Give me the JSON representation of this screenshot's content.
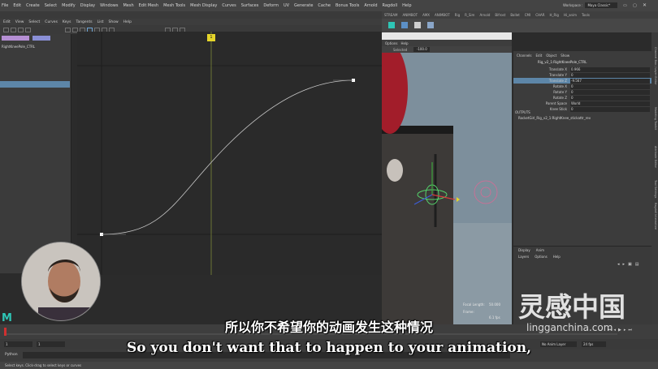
{
  "main_menu": [
    "File",
    "Edit",
    "Create",
    "Select",
    "Modify",
    "Display",
    "Windows",
    "Mesh",
    "Edit Mesh",
    "Mesh Tools",
    "Mesh Display",
    "Curves",
    "Surfaces",
    "Deform",
    "UV",
    "Generate",
    "Cache",
    "Bonus Tools",
    "Arnold",
    "Ragdoll",
    "Help"
  ],
  "workspace": {
    "label": "Workspace :",
    "value": "Maya Classic*"
  },
  "shelf_tabs": [
    "STREAM",
    "ANIMBOT",
    "AMX",
    "ANIMBOT",
    "Rig",
    "R_Sim",
    "Arnold",
    "Bifrost",
    "Ballet",
    "CMI",
    "CHAR",
    "H_Rig",
    "Hi_anim",
    "Tools"
  ],
  "graph_editor": {
    "menu": [
      "Edit",
      "View",
      "Select",
      "Curves",
      "Keys",
      "Tangents",
      "List",
      "Show",
      "Help"
    ],
    "node": "RightKneePole_CTRL",
    "frame_marker": "1",
    "curve_color": "#c8c8c8",
    "timeline_color": "#b5c24a"
  },
  "viewport": {
    "menu": [
      "Options",
      "Help"
    ],
    "selected_label": "Selected",
    "selected_value": "-100.0",
    "hud": {
      "focal_label": "Focal Length:",
      "focal_value": "50.000",
      "frame_label": "Frame:",
      "fps": "6.1 fps"
    }
  },
  "channel_box": {
    "tabs": [
      "Channels",
      "Edit",
      "Object",
      "Show"
    ],
    "node": "Rig_v2_1:RightKneePole_CTRL",
    "attributes": [
      {
        "name": "Translate X",
        "value": "0.966",
        "selected": false
      },
      {
        "name": "Translate Y",
        "value": "0",
        "selected": false
      },
      {
        "name": "Translate Z",
        "value": "-9.567",
        "selected": true
      },
      {
        "name": "Rotate X",
        "value": "0",
        "selected": false
      },
      {
        "name": "Rotate Y",
        "value": "0",
        "selected": false
      },
      {
        "name": "Rotate Z",
        "value": "0",
        "selected": false
      },
      {
        "name": "Parent Space",
        "value": "World",
        "selected": false
      },
      {
        "name": "Knee Stick",
        "value": "0",
        "selected": false
      }
    ],
    "outputs_label": "OUTPUTS",
    "output_node": "RocketGirl_Rig_v2_1:RightKnee_stickattr_rev"
  },
  "layer_editor": {
    "tabs": [
      "Display",
      "Anim"
    ],
    "menu": [
      "Layers",
      "Options",
      "Help"
    ]
  },
  "right_tabs": [
    "Channel Box / Layer Editor",
    "Modeling Toolkit",
    "Attribute Editor",
    "Tool Settings",
    "Ragdoll Interactive"
  ],
  "range": {
    "start": "1",
    "end": "1",
    "anim_layer": "No Anim Layer",
    "fps": "24 fps"
  },
  "command_line": {
    "lang": "Python"
  },
  "help_line": "Select keys. Click-drag to select keys or curves",
  "subtitles": {
    "cn": "所以你不希望你的动画发生这种情况",
    "en": "So you don't want that to happen to your animation,"
  },
  "watermark": {
    "cn": "灵感中国",
    "url": "lingganchina.com"
  },
  "logo": "M"
}
